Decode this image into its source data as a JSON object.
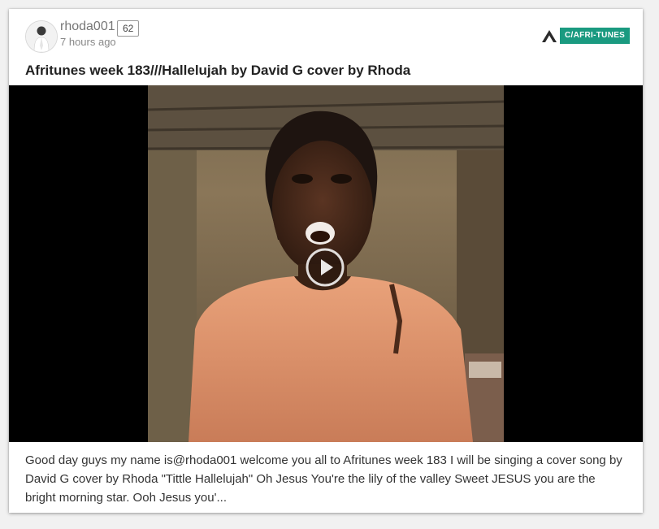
{
  "post": {
    "author": {
      "username": "rhoda001",
      "reputation": "62",
      "posted_ago": "7 hours ago",
      "avatar_icon": "user-avatar"
    },
    "community": {
      "tag": "C/AFRI-TUNES",
      "tag_color": "#1a9a80",
      "logo_icon": "platform-logo-icon"
    },
    "title": "Afritunes week 183///Hallelujah by David G cover by Rhoda",
    "video": {
      "play_icon": "play-icon"
    },
    "excerpt": "Good day guys my name is@rhoda001 welcome you all to Afritunes week 183 I will be singing a cover song by David G cover by Rhoda \"Tittle Hallelujah\" Oh Jesus You're the lily of the valley Sweet JESUS you are the bright morning star. Ooh Jesus you'..."
  }
}
